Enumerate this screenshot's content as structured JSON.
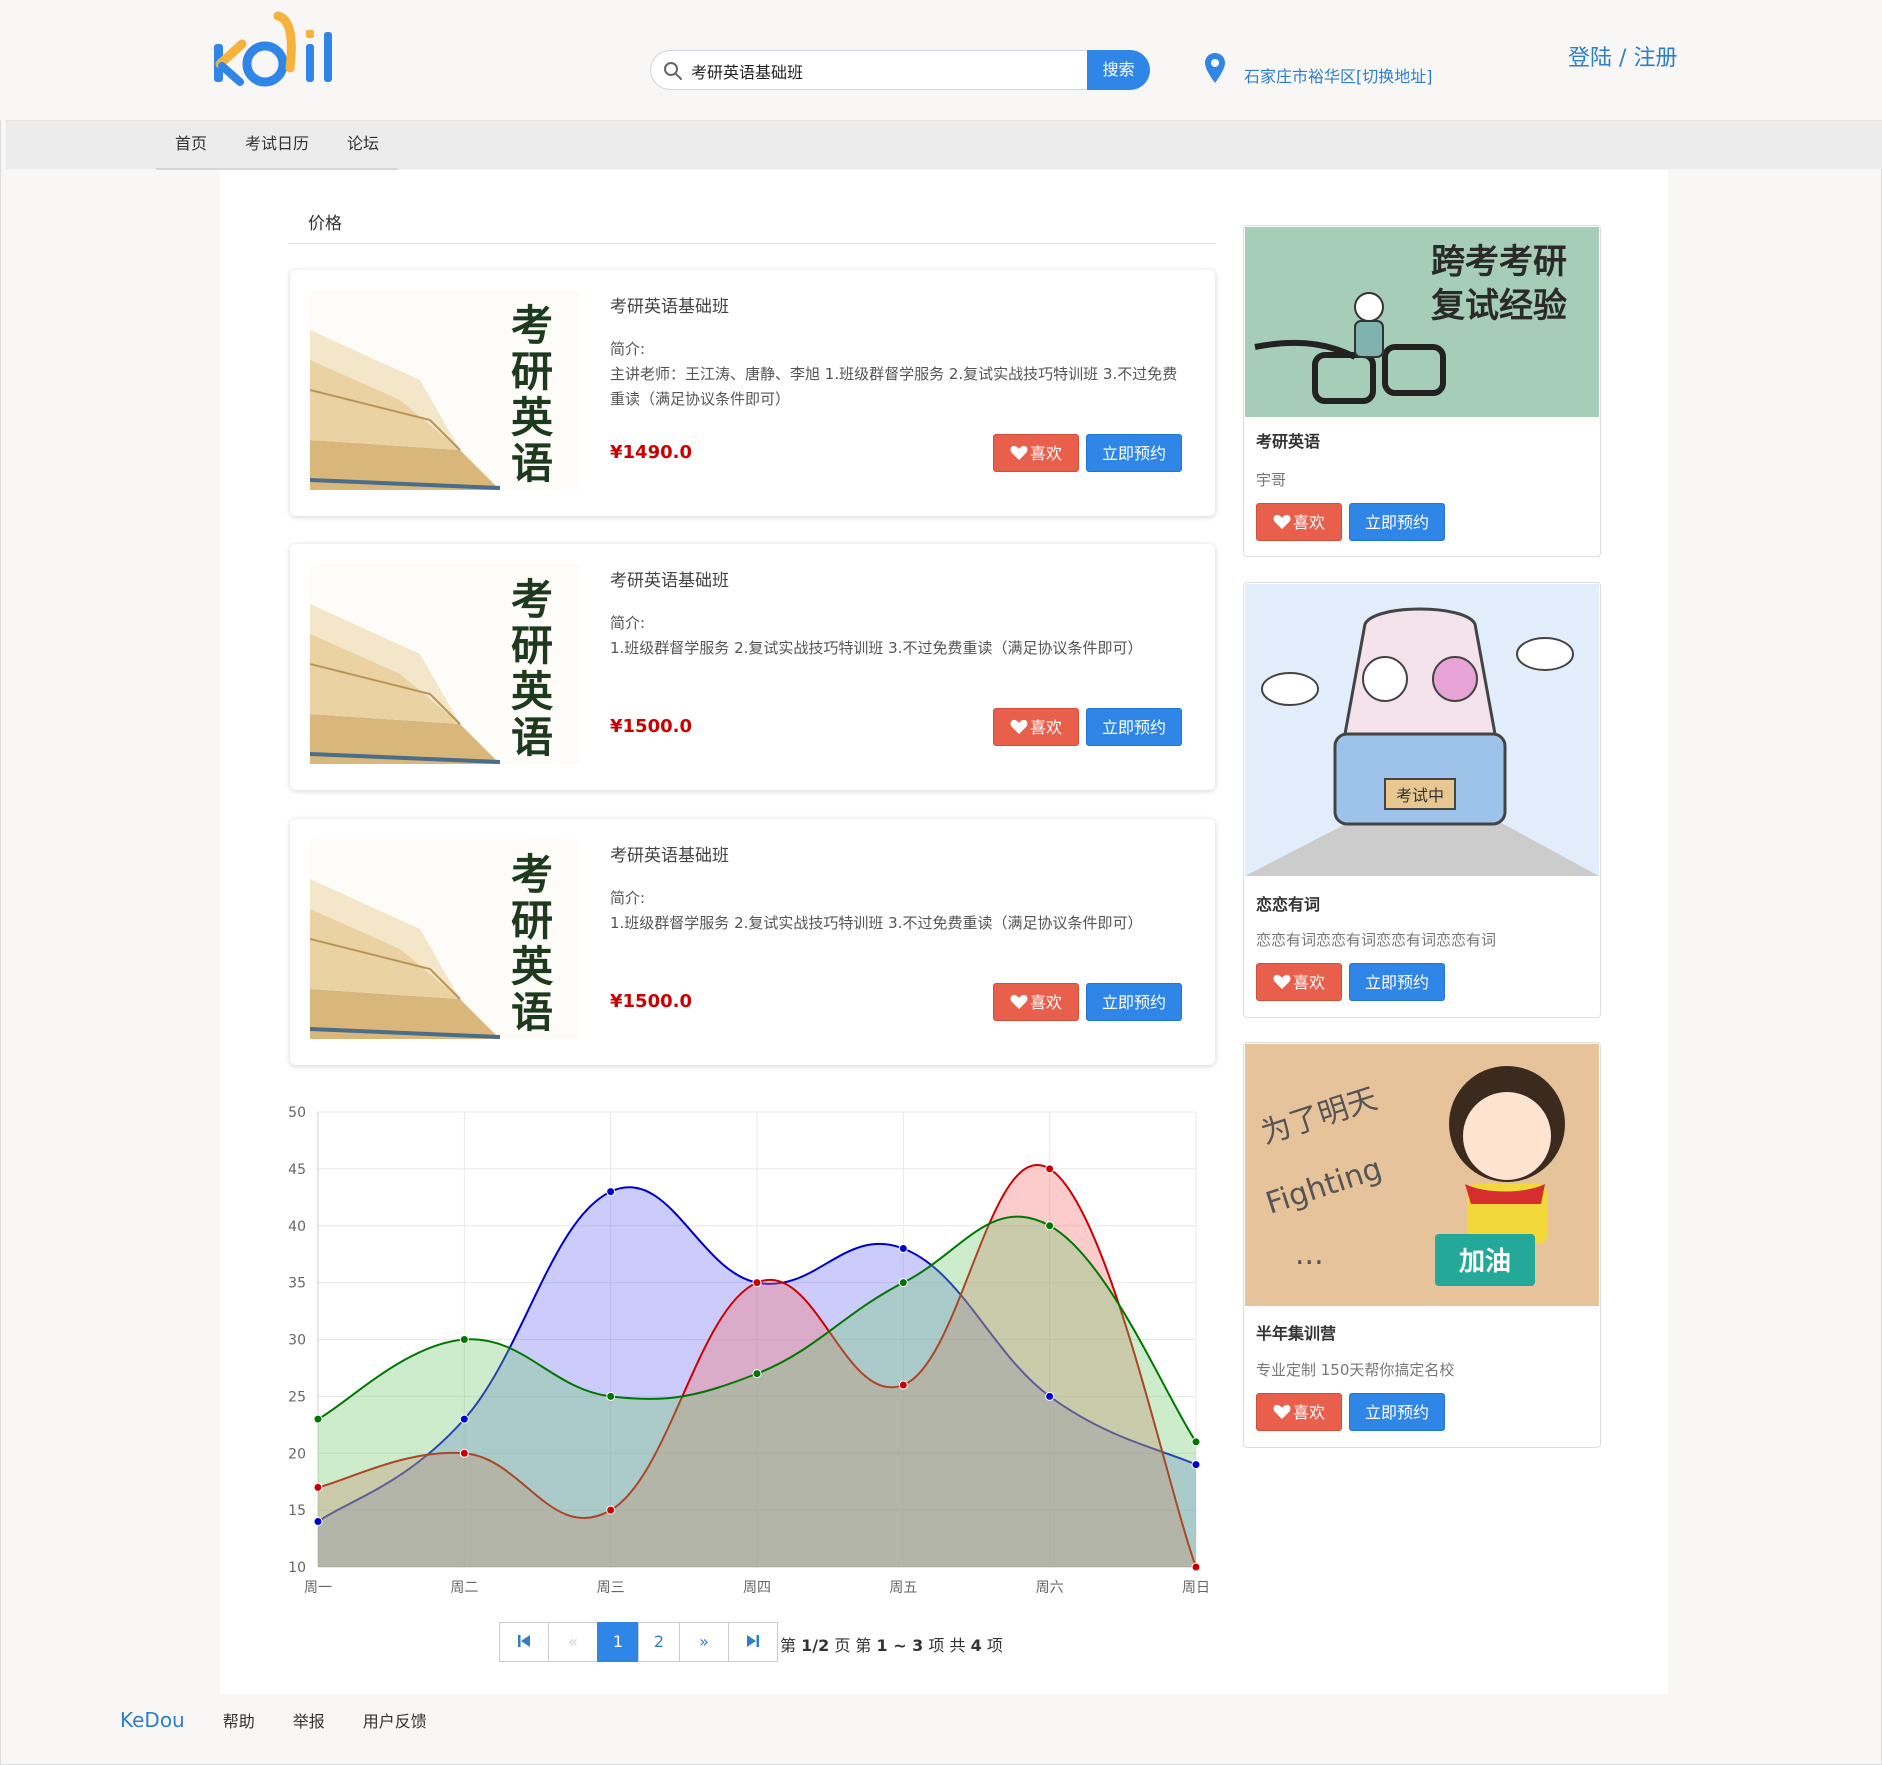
{
  "header": {
    "search_value": "考研英语基础班",
    "search_button": "搜索",
    "location": "石家庄市裕华区[切换地址]",
    "login": "登陆",
    "separator": "/",
    "register": "注册"
  },
  "nav": {
    "items": [
      "首页",
      "考试日历",
      "论坛"
    ]
  },
  "filter": {
    "price_tab": "价格"
  },
  "courses": [
    {
      "title": "考研英语基础班",
      "intro_label": "简介:",
      "desc": "主讲老师：王江涛、唐静、李旭 1.班级群督学服务 2.复试实战技巧特训班 3.不过免费重读（满足协议条件即可）",
      "price": "¥1490.0",
      "cover_text": [
        "考",
        "研",
        "英",
        "语"
      ]
    },
    {
      "title": "考研英语基础班",
      "intro_label": "简介:",
      "desc": "1.班级群督学服务 2.复试实战技巧特训班 3.不过免费重读（满足协议条件即可）",
      "price": "¥1500.0",
      "cover_text": [
        "考",
        "研",
        "英",
        "语"
      ]
    },
    {
      "title": "考研英语基础班",
      "intro_label": "简介:",
      "desc": "1.班级群督学服务 2.复试实战技巧特训班 3.不过免费重读（满足协议条件即可）",
      "price": "¥1500.0",
      "cover_text": [
        "考",
        "研",
        "英",
        "语"
      ]
    }
  ],
  "buttons": {
    "like": "喜欢",
    "book": "立即预约"
  },
  "sidebar": [
    {
      "title": "考研英语",
      "sub": "宇哥",
      "image_text": [
        "跨考考研",
        "复试经验"
      ]
    },
    {
      "title": "恋恋有词",
      "sub": "恋恋有词恋恋有词恋恋有词恋恋有词",
      "image_text": [
        "考试中"
      ]
    },
    {
      "title": "半年集训营",
      "sub": "专业定制 150天帮你搞定名校",
      "image_text": [
        "为了明天",
        "Fighting",
        "...",
        "加油"
      ]
    }
  ],
  "chart_data": {
    "type": "area",
    "categories": [
      "周一",
      "周二",
      "周三",
      "周四",
      "周五",
      "周六",
      "周日"
    ],
    "ylim": [
      10,
      50
    ],
    "yticks": [
      10,
      15,
      20,
      25,
      30,
      35,
      40,
      45,
      50
    ],
    "grid": true,
    "series": [
      {
        "color": "#0000cc",
        "fill": "rgba(110,110,245,0.35)",
        "values": [
          14,
          23,
          43,
          35,
          38,
          25,
          19
        ]
      },
      {
        "color": "#cc0000",
        "fill": "rgba(245,110,110,0.35)",
        "values": [
          17,
          20,
          15,
          35,
          26,
          45,
          10
        ]
      },
      {
        "color": "#007700",
        "fill": "rgba(110,200,110,0.35)",
        "values": [
          23,
          30,
          25,
          27,
          35,
          40,
          21
        ]
      }
    ]
  },
  "pagination": {
    "first": "⏮",
    "prev": "«",
    "pages": [
      "1",
      "2"
    ],
    "next": "»",
    "last": "⏭",
    "info_pre": "第",
    "info_page": "1/2",
    "info_mid1": "页  第",
    "info_range": "1 ~ 3",
    "info_mid2": "项  共",
    "info_total": "4",
    "info_post": "项"
  },
  "footer": {
    "brand": "KeDou",
    "links": [
      "帮助",
      "举报",
      "用户反馈"
    ]
  }
}
